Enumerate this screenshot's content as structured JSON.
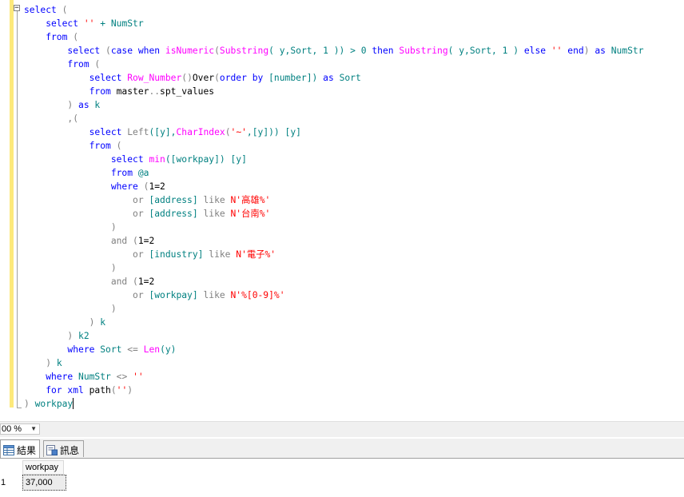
{
  "editor": {
    "lines": [
      [
        {
          "t": "select",
          "c": "kw"
        },
        {
          "t": " (",
          "c": "gray"
        }
      ],
      [
        {
          "t": "    select",
          "c": "kw"
        },
        {
          "t": " ",
          "c": "plain"
        },
        {
          "t": "''",
          "c": "str"
        },
        {
          "t": " + NumStr",
          "c": "ob"
        }
      ],
      [
        {
          "t": "    from",
          "c": "kw"
        },
        {
          "t": " (",
          "c": "gray"
        }
      ],
      [
        {
          "t": "        select",
          "c": "kw"
        },
        {
          "t": " (",
          "c": "gray"
        },
        {
          "t": "case",
          "c": "kw"
        },
        {
          "t": " ",
          "c": "plain"
        },
        {
          "t": "when",
          "c": "kw"
        },
        {
          "t": " ",
          "c": "plain"
        },
        {
          "t": "isNumeric",
          "c": "fn"
        },
        {
          "t": "(",
          "c": "gray"
        },
        {
          "t": "Substring",
          "c": "fn"
        },
        {
          "t": "( y,Sort, 1 )) > 0 ",
          "c": "ob"
        },
        {
          "t": "then",
          "c": "kw"
        },
        {
          "t": " ",
          "c": "plain"
        },
        {
          "t": "Substring",
          "c": "fn"
        },
        {
          "t": "( y,Sort, 1 ) ",
          "c": "ob"
        },
        {
          "t": "else",
          "c": "kw"
        },
        {
          "t": " ",
          "c": "plain"
        },
        {
          "t": "''",
          "c": "str"
        },
        {
          "t": " ",
          "c": "plain"
        },
        {
          "t": "end",
          "c": "kw"
        },
        {
          "t": ") ",
          "c": "gray"
        },
        {
          "t": "as",
          "c": "kw"
        },
        {
          "t": " NumStr",
          "c": "ob"
        }
      ],
      [
        {
          "t": "        from",
          "c": "kw"
        },
        {
          "t": " (",
          "c": "gray"
        }
      ],
      [
        {
          "t": "            select",
          "c": "kw"
        },
        {
          "t": " ",
          "c": "plain"
        },
        {
          "t": "Row_Number",
          "c": "fn"
        },
        {
          "t": "()",
          "c": "gray"
        },
        {
          "t": "Over",
          "c": "plain"
        },
        {
          "t": "(",
          "c": "gray"
        },
        {
          "t": "order by",
          "c": "kw"
        },
        {
          "t": " [number]) ",
          "c": "ob"
        },
        {
          "t": "as",
          "c": "kw"
        },
        {
          "t": " Sort",
          "c": "ob"
        }
      ],
      [
        {
          "t": "            from",
          "c": "kw"
        },
        {
          "t": " master",
          "c": "plain"
        },
        {
          "t": "..",
          "c": "gray"
        },
        {
          "t": "spt_values",
          "c": "plain"
        }
      ],
      [
        {
          "t": "        ) ",
          "c": "gray"
        },
        {
          "t": "as",
          "c": "kw"
        },
        {
          "t": " k",
          "c": "ob"
        }
      ],
      [
        {
          "t": "        ,(",
          "c": "gray"
        }
      ],
      [
        {
          "t": "            select",
          "c": "kw"
        },
        {
          "t": " ",
          "c": "plain"
        },
        {
          "t": "Left",
          "c": "gray"
        },
        {
          "t": "([y],",
          "c": "ob"
        },
        {
          "t": "CharIndex",
          "c": "fn"
        },
        {
          "t": "(",
          "c": "gray"
        },
        {
          "t": "'~'",
          "c": "str"
        },
        {
          "t": ",[y])) [y]",
          "c": "ob"
        }
      ],
      [
        {
          "t": "            from",
          "c": "kw"
        },
        {
          "t": " (",
          "c": "gray"
        }
      ],
      [
        {
          "t": "                select",
          "c": "kw"
        },
        {
          "t": " ",
          "c": "plain"
        },
        {
          "t": "min",
          "c": "fn"
        },
        {
          "t": "([workpay]) [y]",
          "c": "ob"
        }
      ],
      [
        {
          "t": "                from",
          "c": "kw"
        },
        {
          "t": " @a",
          "c": "ob"
        }
      ],
      [
        {
          "t": "                where",
          "c": "kw"
        },
        {
          "t": " (",
          "c": "gray"
        },
        {
          "t": "1=2",
          "c": "plain"
        }
      ],
      [
        {
          "t": "                    or",
          "c": "gray"
        },
        {
          "t": " [address] ",
          "c": "ob"
        },
        {
          "t": "like",
          "c": "gray"
        },
        {
          "t": " ",
          "c": "plain"
        },
        {
          "t": "N'高雄%'",
          "c": "str"
        }
      ],
      [
        {
          "t": "                    or",
          "c": "gray"
        },
        {
          "t": " [address] ",
          "c": "ob"
        },
        {
          "t": "like",
          "c": "gray"
        },
        {
          "t": " ",
          "c": "plain"
        },
        {
          "t": "N'台南%'",
          "c": "str"
        }
      ],
      [
        {
          "t": "                )",
          "c": "gray"
        }
      ],
      [
        {
          "t": "                and",
          "c": "gray"
        },
        {
          "t": " (",
          "c": "gray"
        },
        {
          "t": "1=2",
          "c": "plain"
        }
      ],
      [
        {
          "t": "                    or",
          "c": "gray"
        },
        {
          "t": " [industry] ",
          "c": "ob"
        },
        {
          "t": "like",
          "c": "gray"
        },
        {
          "t": " ",
          "c": "plain"
        },
        {
          "t": "N'電子%'",
          "c": "str"
        }
      ],
      [
        {
          "t": "                )",
          "c": "gray"
        }
      ],
      [
        {
          "t": "                and",
          "c": "gray"
        },
        {
          "t": " (",
          "c": "gray"
        },
        {
          "t": "1=2",
          "c": "plain"
        }
      ],
      [
        {
          "t": "                    or",
          "c": "gray"
        },
        {
          "t": " [workpay] ",
          "c": "ob"
        },
        {
          "t": "like",
          "c": "gray"
        },
        {
          "t": " ",
          "c": "plain"
        },
        {
          "t": "N'%[0-9]%'",
          "c": "str"
        }
      ],
      [
        {
          "t": "                )",
          "c": "gray"
        }
      ],
      [
        {
          "t": "            ) ",
          "c": "gray"
        },
        {
          "t": "k",
          "c": "ob"
        }
      ],
      [
        {
          "t": "        ) ",
          "c": "gray"
        },
        {
          "t": "k2",
          "c": "ob"
        }
      ],
      [
        {
          "t": "        where",
          "c": "kw"
        },
        {
          "t": " Sort ",
          "c": "ob"
        },
        {
          "t": "<=",
          "c": "gray"
        },
        {
          "t": " ",
          "c": "plain"
        },
        {
          "t": "Len",
          "c": "fn"
        },
        {
          "t": "(y)",
          "c": "ob"
        }
      ],
      [
        {
          "t": "    ) ",
          "c": "gray"
        },
        {
          "t": "k",
          "c": "ob"
        }
      ],
      [
        {
          "t": "    where",
          "c": "kw"
        },
        {
          "t": " NumStr ",
          "c": "ob"
        },
        {
          "t": "<>",
          "c": "gray"
        },
        {
          "t": " ",
          "c": "plain"
        },
        {
          "t": "''",
          "c": "str"
        }
      ],
      [
        {
          "t": "    for",
          "c": "kw"
        },
        {
          "t": " ",
          "c": "plain"
        },
        {
          "t": "xml",
          "c": "kw"
        },
        {
          "t": " path",
          "c": "plain"
        },
        {
          "t": "(",
          "c": "gray"
        },
        {
          "t": "''",
          "c": "str"
        },
        {
          "t": ")",
          "c": "gray"
        }
      ],
      [
        {
          "t": ") ",
          "c": "gray"
        },
        {
          "t": "workpay",
          "c": "ob"
        }
      ]
    ]
  },
  "statusbar": {
    "zoom": "00 %"
  },
  "tabs": {
    "results_label": "結果",
    "messages_label": "訊息"
  },
  "grid": {
    "columns": [
      "workpay"
    ],
    "rows": [
      {
        "num": "1",
        "values": [
          "37,000"
        ]
      }
    ]
  },
  "colors": {
    "keyword": "#0000ff",
    "function": "#ff00ff",
    "string": "#ff0000",
    "operator": "#808080",
    "object": "#008080",
    "change_bar": "#fde97b"
  },
  "icons": {
    "fold": "collapse-minus-icon",
    "results_tab": "grid-icon",
    "messages_tab": "message-icon",
    "zoom_dropdown": "chevron-down-icon"
  }
}
